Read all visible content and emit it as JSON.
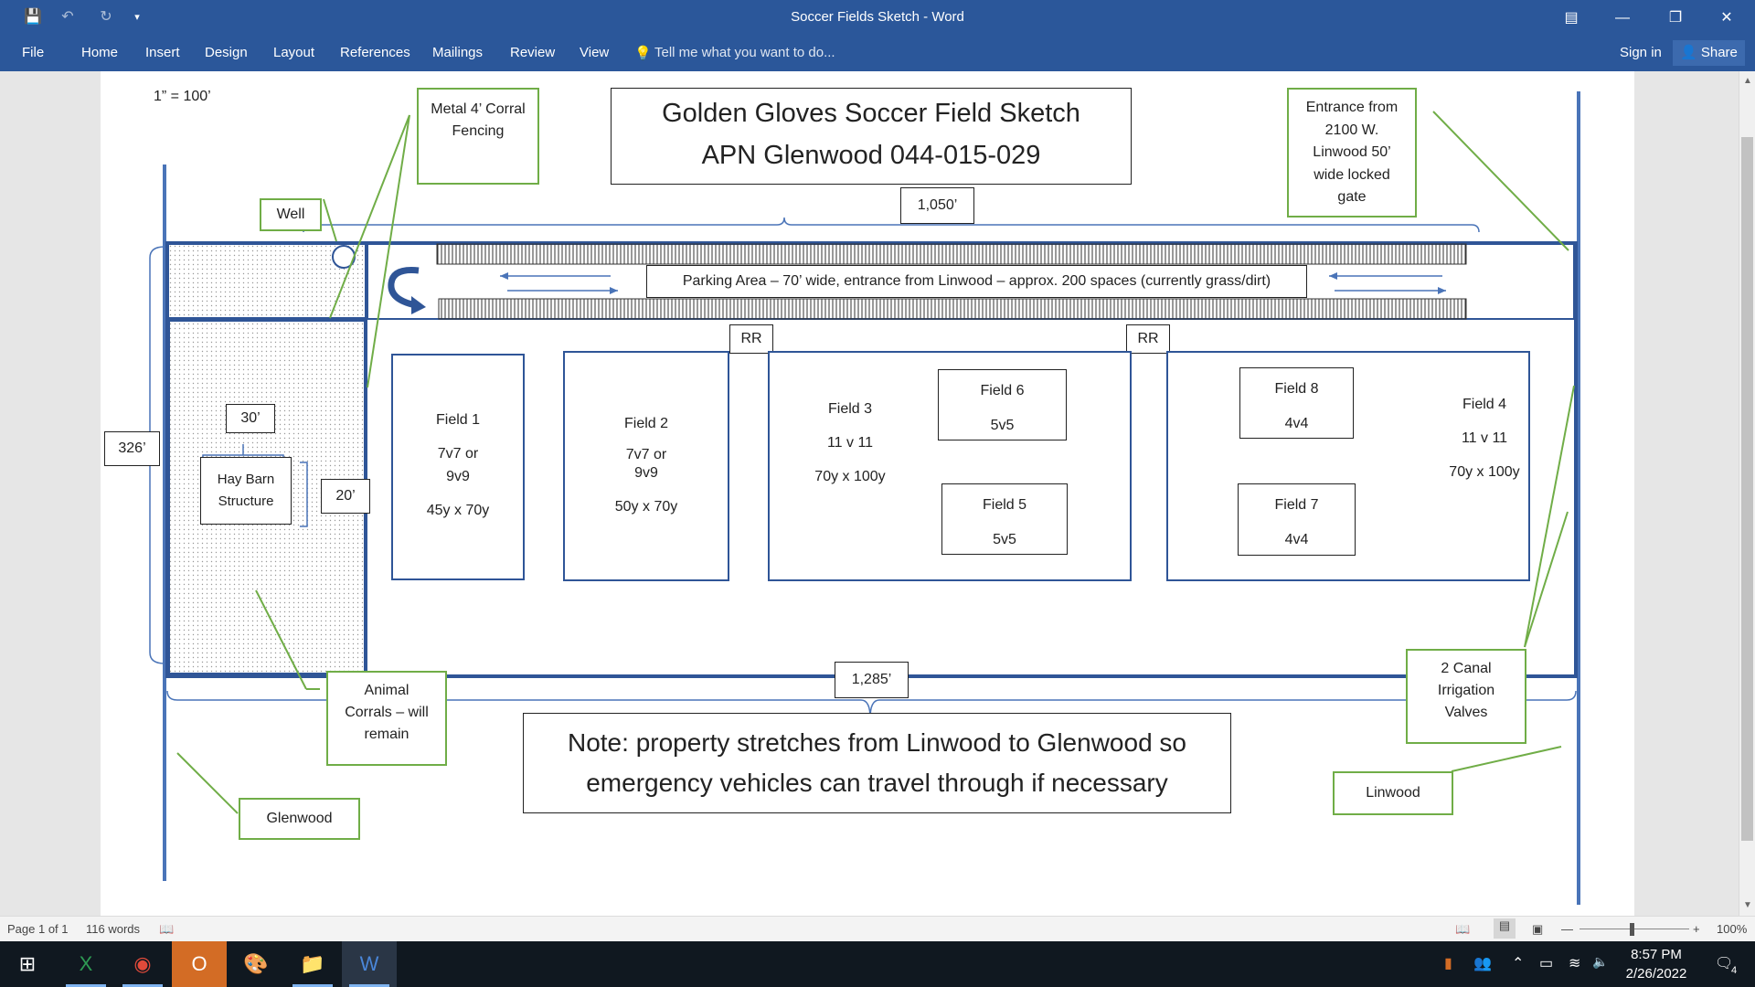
{
  "window": {
    "title": "Soccer Fields Sketch - Word",
    "save_icon": "save-icon",
    "undo_icon": "undo-icon",
    "redo_icon": "redo-icon",
    "customize_icon": "customize-qat-icon"
  },
  "ribbon": {
    "tabs": [
      "File",
      "Home",
      "Insert",
      "Design",
      "Layout",
      "References",
      "Mailings",
      "Review",
      "View"
    ],
    "tell_me": "Tell me what you want to do...",
    "sign_in": "Sign in",
    "share": "Share"
  },
  "sketch": {
    "scale": "1” = 100’",
    "title_line1": "Golden Gloves Soccer Field Sketch",
    "title_line2": "APN Glenwood 044-015-029",
    "dim_top": "1,050’",
    "dim_bottom": "1,285’",
    "dim_left": "326’",
    "dim_barn_width": "30’",
    "dim_barn_depth": "20’",
    "callouts": {
      "fencing": "Metal 4’ Corral Fencing",
      "entrance": "Entrance from 2100 W. Linwood 50’ wide locked gate",
      "well": "Well",
      "corrals": "Animal Corrals – will remain",
      "glenwood": "Glenwood",
      "valves": "2 Canal Irrigation Valves",
      "linwood": "Linwood"
    },
    "hay_barn": "Hay Barn Structure",
    "parking": "Parking Area – 70’ wide, entrance from Linwood – approx. 200 spaces (currently grass/dirt)",
    "restroom_label": "RR",
    "fields": {
      "f1": {
        "name": "Field 1",
        "format": "7v7 or 9v9",
        "size": "45y x 70y"
      },
      "f2": {
        "name": "Field 2",
        "format": "7v7 or 9v9",
        "size": "50y x 70y"
      },
      "f3": {
        "name": "Field 3",
        "format": "11 v 11",
        "size": "70y x 100y"
      },
      "f4": {
        "name": "Field 4",
        "format": "11 v 11",
        "size": "70y x 100y"
      },
      "f5": {
        "name": "Field 5",
        "format": "5v5"
      },
      "f6": {
        "name": "Field 6",
        "format": "5v5"
      },
      "f7": {
        "name": "Field 7",
        "format": "4v4"
      },
      "f8": {
        "name": "Field 8",
        "format": "4v4"
      }
    },
    "note": "Note:  property stretches from Linwood to Glenwood so emergency vehicles can travel through if necessary"
  },
  "status": {
    "page": "Page 1 of 1",
    "words": "116 words",
    "zoom": "100%"
  },
  "taskbar": {
    "time": "8:57 PM",
    "date": "2/26/2022",
    "notifications": "4"
  }
}
